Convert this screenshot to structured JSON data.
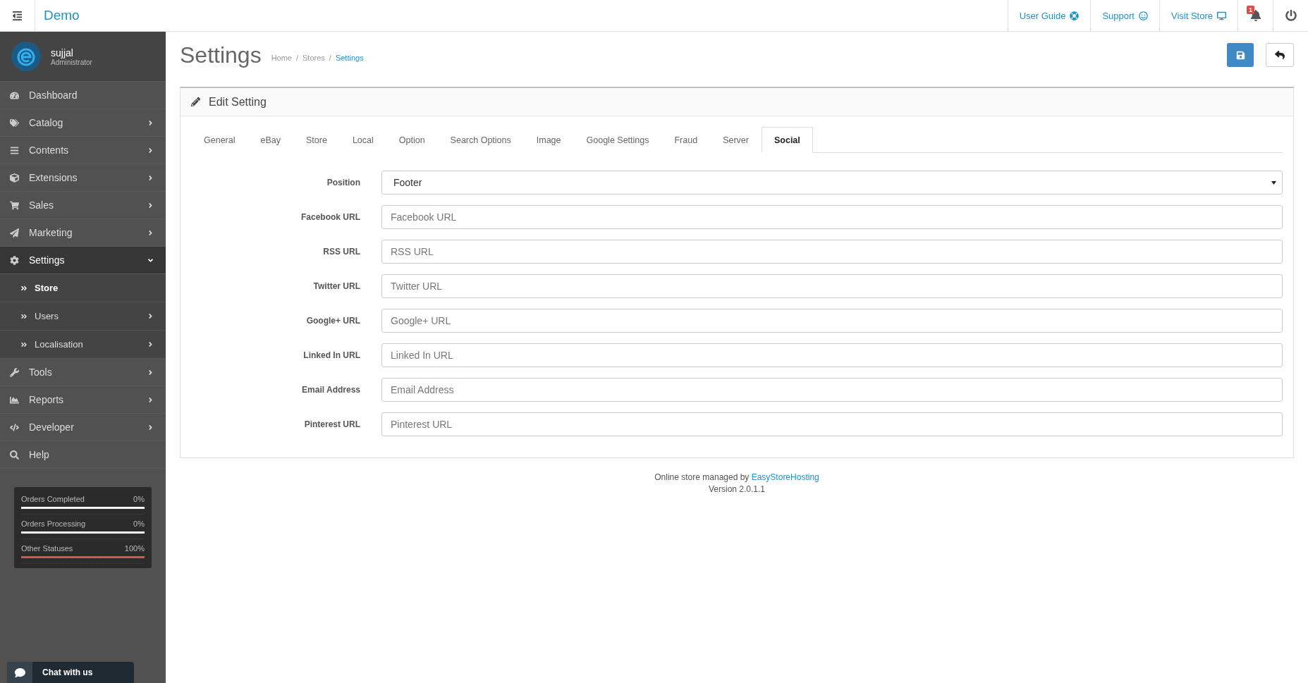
{
  "header": {
    "brand": "Demo",
    "links": [
      {
        "label": "User Guide"
      },
      {
        "label": "Support"
      },
      {
        "label": "Visit Store"
      }
    ],
    "notifications_badge": "1"
  },
  "sidebar": {
    "user": {
      "name": "sujjal",
      "role": "Administrator"
    },
    "items": [
      {
        "label": "Dashboard",
        "kind": "link",
        "expanded": false
      },
      {
        "label": "Catalog",
        "kind": "group",
        "expanded": false
      },
      {
        "label": "Contents",
        "kind": "group",
        "expanded": false
      },
      {
        "label": "Extensions",
        "kind": "group",
        "expanded": false
      },
      {
        "label": "Sales",
        "kind": "group",
        "expanded": false
      },
      {
        "label": "Marketing",
        "kind": "group",
        "expanded": false
      },
      {
        "label": "Settings",
        "kind": "group",
        "expanded": true,
        "children": [
          {
            "label": "Store",
            "kind": "link",
            "selected": true
          },
          {
            "label": "Users",
            "kind": "group",
            "selected": false
          },
          {
            "label": "Localisation",
            "kind": "group",
            "selected": false
          }
        ]
      },
      {
        "label": "Tools",
        "kind": "group",
        "expanded": false
      },
      {
        "label": "Reports",
        "kind": "group",
        "expanded": false
      },
      {
        "label": "Developer",
        "kind": "group",
        "expanded": false
      },
      {
        "label": "Help",
        "kind": "link",
        "expanded": false
      }
    ],
    "stats": [
      {
        "label": "Orders Completed",
        "reading": "0%",
        "level": 0
      },
      {
        "label": "Orders Processing",
        "reading": "0%",
        "level": 0
      },
      {
        "label": "Other Statuses",
        "reading": "100%",
        "level": 1
      }
    ],
    "chat": "Chat with us"
  },
  "page": {
    "title": "Settings",
    "breadcrumb": [
      {
        "label": "Home",
        "current": false
      },
      {
        "label": "Stores",
        "current": false,
        "separator": "/"
      },
      {
        "label": "Settings",
        "current": true,
        "separator": "/"
      }
    ]
  },
  "panel": {
    "title": "Edit Setting",
    "tabs": [
      {
        "label": "General",
        "selected": false
      },
      {
        "label": "eBay",
        "selected": false
      },
      {
        "label": "Store",
        "selected": false
      },
      {
        "label": "Local",
        "selected": false
      },
      {
        "label": "Option",
        "selected": false
      },
      {
        "label": "Search Options",
        "selected": false
      },
      {
        "label": "Image",
        "selected": false
      },
      {
        "label": "Google Settings",
        "selected": false
      },
      {
        "label": "Fraud",
        "selected": false
      },
      {
        "label": "Server",
        "selected": false
      },
      {
        "label": "Social",
        "selected": true
      }
    ],
    "fields": [
      {
        "label": "Position",
        "kind": "select",
        "value": "Footer"
      },
      {
        "label": "Facebook URL",
        "kind": "text",
        "placeholder": "Facebook URL"
      },
      {
        "label": "RSS URL",
        "kind": "text",
        "placeholder": "RSS URL"
      },
      {
        "label": "Twitter URL",
        "kind": "text",
        "placeholder": "Twitter URL"
      },
      {
        "label": "Google+ URL",
        "kind": "text",
        "placeholder": "Google+ URL"
      },
      {
        "label": "Linked In URL",
        "kind": "text",
        "placeholder": "Linked In URL"
      },
      {
        "label": "Email Address",
        "kind": "text",
        "placeholder": "Email Address"
      },
      {
        "label": "Pinterest URL",
        "kind": "text",
        "placeholder": "Pinterest URL"
      }
    ]
  },
  "footer": {
    "text": "Online store managed by",
    "link": "EasyStoreHosting",
    "version": "Version 2.0.1.1"
  }
}
